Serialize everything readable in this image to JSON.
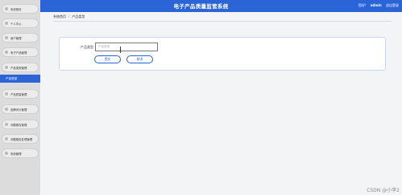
{
  "header": {
    "title": "电子产品质量监管系统",
    "user_greeting": "您好!",
    "user_name": "admin",
    "logout_label": "退出登录"
  },
  "sidebar": {
    "items": [
      {
        "label": "系统首页"
      },
      {
        "label": "个人中心"
      },
      {
        "label": "用户管理"
      },
      {
        "label": "电子产品管理"
      },
      {
        "label": "产品类型管理"
      },
      {
        "label": "产品类型",
        "active": true
      },
      {
        "label": "产品质量管理"
      },
      {
        "label": "品牌评价管理"
      },
      {
        "label": "问题报告管理"
      },
      {
        "label": "问题报告处理管理"
      },
      {
        "label": "系统管理"
      }
    ]
  },
  "breadcrumb": {
    "home": "系统首页",
    "current": "产品类型"
  },
  "form": {
    "field_label": "产品类型",
    "field_placeholder": "产品类型",
    "submit_label": "提交",
    "cancel_label": "取消"
  },
  "watermark": "CSDN @小李2",
  "colors": {
    "primary": "#2b64d6",
    "sidebar_bg": "#dcdcdc",
    "page_bg": "#f3f4f6"
  }
}
